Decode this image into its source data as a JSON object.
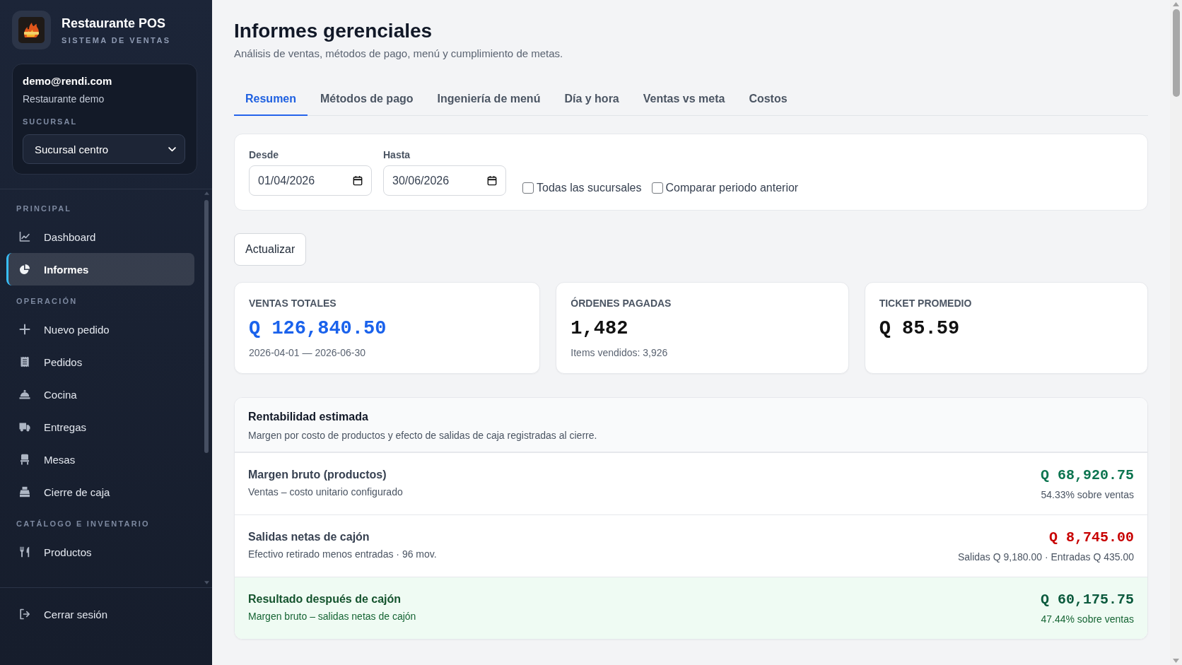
{
  "sidebar": {
    "brand": {
      "title": "Restaurante POS",
      "subtitle": "SISTEMA DE VENTAS"
    },
    "account": {
      "email": "demo@rendi.com",
      "business": "Restaurante demo",
      "branch_label": "SUCURSAL",
      "branch_select": {
        "value": "Sucursal centro"
      }
    },
    "sections": [
      {
        "title": "PRINCIPAL",
        "items": [
          {
            "label": "Dashboard",
            "selected": false
          },
          {
            "label": "Informes",
            "selected": true
          }
        ]
      },
      {
        "title": "OPERACIÓN",
        "items": [
          {
            "label": "Nuevo pedido",
            "selected": false
          },
          {
            "label": "Pedidos",
            "selected": false
          },
          {
            "label": "Cocina",
            "selected": false
          },
          {
            "label": "Entregas",
            "selected": false
          },
          {
            "label": "Mesas",
            "selected": false
          },
          {
            "label": "Cierre de caja",
            "selected": false
          }
        ]
      },
      {
        "title": "CATÁLOGO E INVENTARIO",
        "items": [
          {
            "label": "Productos",
            "selected": false
          }
        ]
      }
    ],
    "logout": {
      "label": "Cerrar sesión"
    }
  },
  "header": {
    "title": "Informes gerenciales",
    "subtitle": "Análisis de ventas, métodos de pago, menú y cumplimiento de metas."
  },
  "tabs": [
    {
      "label": "Resumen",
      "selected": true
    },
    {
      "label": "Métodos de pago",
      "selected": false
    },
    {
      "label": "Ingeniería de menú",
      "selected": false
    },
    {
      "label": "Día y hora",
      "selected": false
    },
    {
      "label": "Ventas vs meta",
      "selected": false
    },
    {
      "label": "Costos",
      "selected": false
    }
  ],
  "filters": {
    "date_fields": [
      {
        "label": "Desde",
        "value": "01/04/2026"
      },
      {
        "label": "Hasta",
        "value": "30/06/2026"
      }
    ],
    "checkboxes": [
      {
        "label": "Todas las sucursales",
        "checked": false
      },
      {
        "label": "Comparar periodo anterior",
        "checked": false
      }
    ]
  },
  "refresh_button": {
    "label": "Actualizar"
  },
  "stats": [
    {
      "label": "VENTAS TOTALES",
      "value": "Q 126,840.50",
      "note": "2026-04-01 — 2026-06-30",
      "highlighted": true
    },
    {
      "label": "ÓRDENES PAGADAS",
      "value": "1,482",
      "note": "Items vendidos: 3,926",
      "highlighted": false
    },
    {
      "label": "TICKET PROMEDIO",
      "value": "Q 85.59",
      "highlighted": false
    }
  ],
  "profitability": {
    "title": "Rentabilidad estimada",
    "description": "Margen por costo de productos y efecto de salidas de caja registradas al cierre.",
    "rows": [
      {
        "kind": "gain",
        "title": "Margen bruto (productos)",
        "description": "Ventas – costo unitario configurado",
        "amount": "Q 68,920.75",
        "detail": "54.33% sobre ventas"
      },
      {
        "kind": "loss",
        "title": "Salidas netas de cajón",
        "description": "Efectivo retirado menos entradas · 96 mov.",
        "amount": "Q 8,745.00",
        "detail": "Salidas Q 9,180.00 · Entradas Q 435.00"
      },
      {
        "kind": "total",
        "title": "Resultado después de cajón",
        "description": "Margen bruto – salidas netas de cajón",
        "amount": "Q 60,175.75",
        "detail": "47.44% sobre ventas"
      }
    ]
  }
}
